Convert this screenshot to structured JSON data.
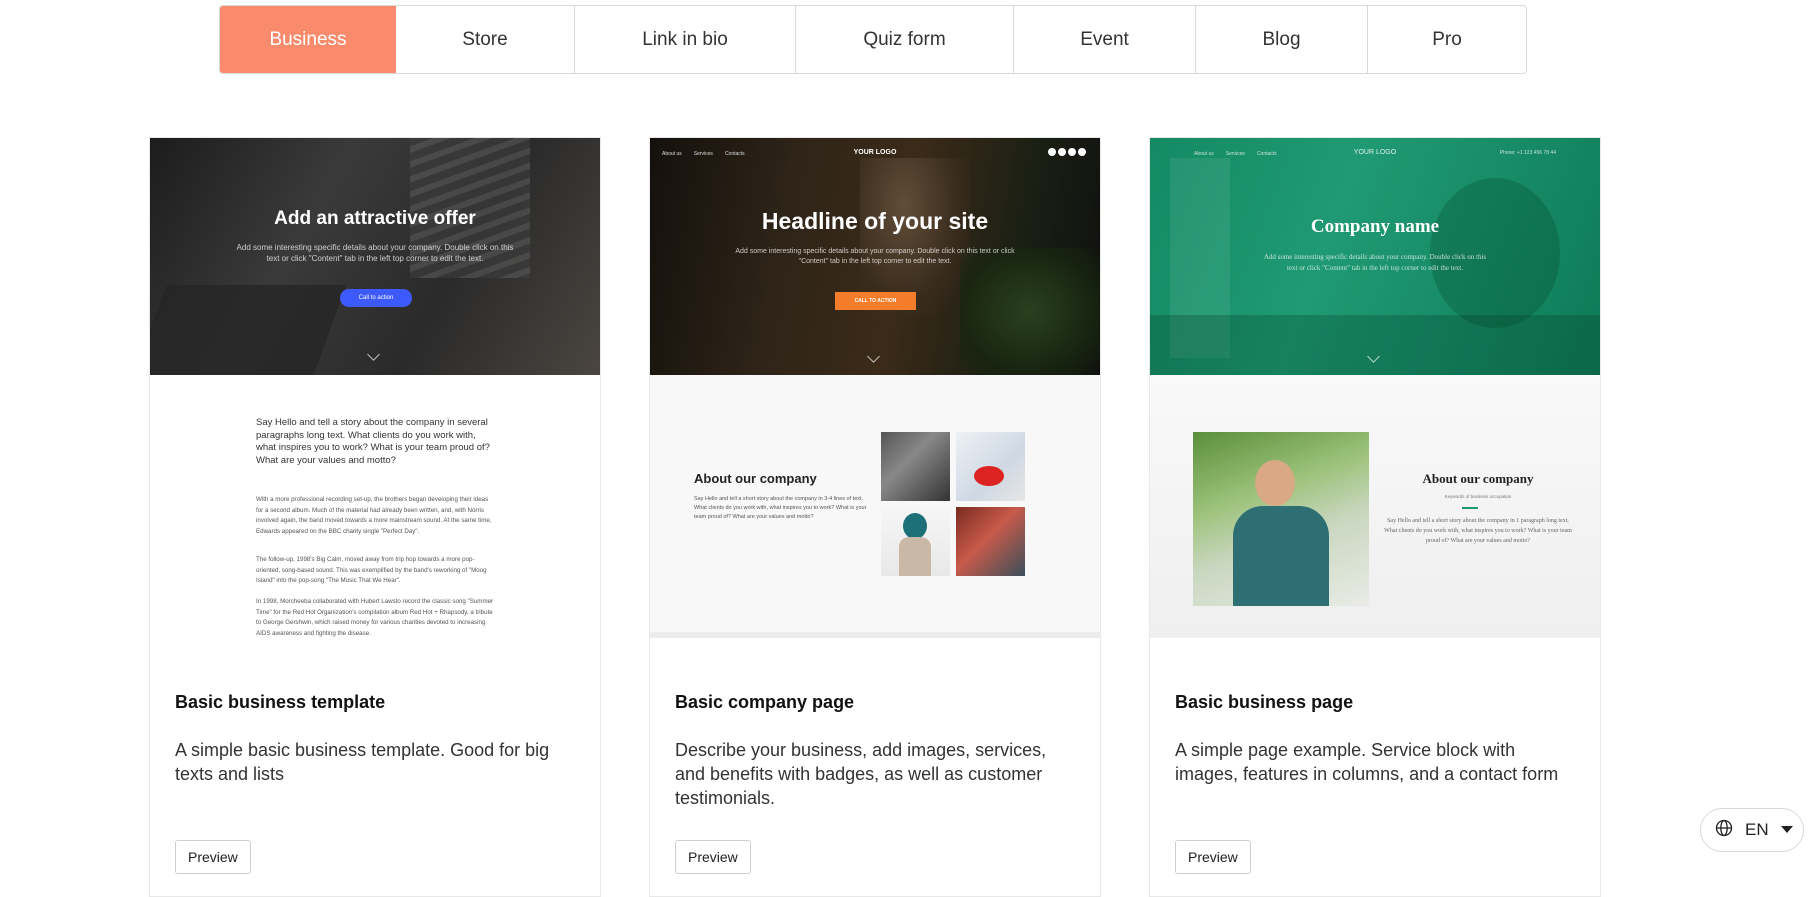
{
  "tabs": [
    {
      "label": "Business",
      "active": true
    },
    {
      "label": "Store"
    },
    {
      "label": "Link in bio"
    },
    {
      "label": "Quiz form"
    },
    {
      "label": "Event"
    },
    {
      "label": "Blog"
    },
    {
      "label": "Pro"
    }
  ],
  "accent_color": "#fa8a6c",
  "cards": [
    {
      "title": "Basic business template",
      "description": "A simple basic business template. Good for big texts and lists",
      "preview_label": "Preview",
      "thumb": {
        "headline": "Add an attractive offer",
        "subtext": "Add some interesting specific details about your company. Double click on this text or click \"Content\" tab in the left top corner to edit the text.",
        "cta": "Call to action",
        "intro": "Say Hello and tell a story about the company in several paragraphs long text. What clients do you work with, what inspires you to work? What is your team proud of? What are your values and motto?",
        "paragraphs": [
          "With a more professional recording set-up, the brothers began developing their ideas for a second album. Much of the material had already been written, and, with Norris involved again, the band moved towards a more mainstream sound. At the same time, Edwards appeared on the BBC charity single \"Perfect Day\".",
          "The follow-up, 1998's Big Calm, moved away from trip hop towards a more pop-oriented, song-based sound. This was exemplified by the band's reworking of \"Moog Island\" into the pop-song \"The Music That We Hear\".",
          "In 1998, Morcheeba collaborated with Hubert Lawsto record the classic song \"Summer Time\" for the Red Hot Organization's compilation album Red Hot + Rhapsody, a tribute to George Gershwin, which raised money for various charities devoted to increasing AIDS awareness and fighting the disease."
        ]
      }
    },
    {
      "title": "Basic company page",
      "description": "Describe your business, add images, services, and benefits with badges, as well as customer testimonials.",
      "preview_label": "Preview",
      "thumb": {
        "nav": [
          "About us",
          "Services",
          "Contacts"
        ],
        "logo": "YOUR LOGO",
        "headline": "Headline of your site",
        "subtext": "Add some interesting specific details about your company. Double click on this text or click \"Content\" tab in the left top corner to edit the text.",
        "cta": "CALL TO ACTION",
        "about_title": "About our company",
        "about_text": "Say Hello and tell a short story about the company in 3-4 lines of text. What clients do you work with, what inspires you to work? What is your team proud of? What are your values and motto?"
      }
    },
    {
      "title": "Basic business page",
      "description": "A simple page example. Service block with images, features in columns, and a contact form",
      "preview_label": "Preview",
      "thumb": {
        "nav": [
          "About us",
          "Services",
          "Contacts"
        ],
        "logo": "YOUR LOGO",
        "phone": "Phone: +1 123 456 78 44",
        "headline": "Company name",
        "subtext": "Add some interesting specific details about your company. Double click on this text or click \"Content\" tab in the left top corner to edit the text.",
        "about_title": "About our company",
        "about_keywords": "Keywords of business occupation",
        "about_text": "Say Hello and tell a short story about the company in 1 paragraph long text. What clients do you work with, what inspires you to work? What is your team proud of? What are your values and motto?"
      }
    }
  ],
  "language": {
    "code": "EN"
  }
}
